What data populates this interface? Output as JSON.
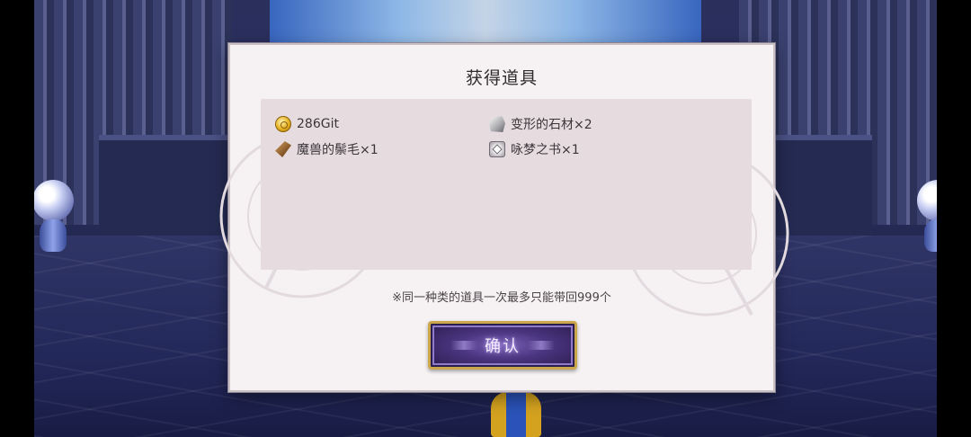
{
  "dialog": {
    "title": "获得道具",
    "items": [
      {
        "icon": "gold-coin-icon",
        "label": "286Git"
      },
      {
        "icon": "stone-material-icon",
        "label": "变形的石材×2"
      },
      {
        "icon": "beast-fur-icon",
        "label": "魔兽的鬃毛×1"
      },
      {
        "icon": "dream-book-icon",
        "label": "咏梦之书×1"
      }
    ],
    "notice": "※同一种类的道具一次最多只能带回999个",
    "confirm_label": "确认"
  },
  "colors": {
    "dialog_bg": "#f6f2f3",
    "panel_bg": "#e6dce0",
    "button_border": "#c9a74a",
    "button_fill": "#4b3580"
  }
}
